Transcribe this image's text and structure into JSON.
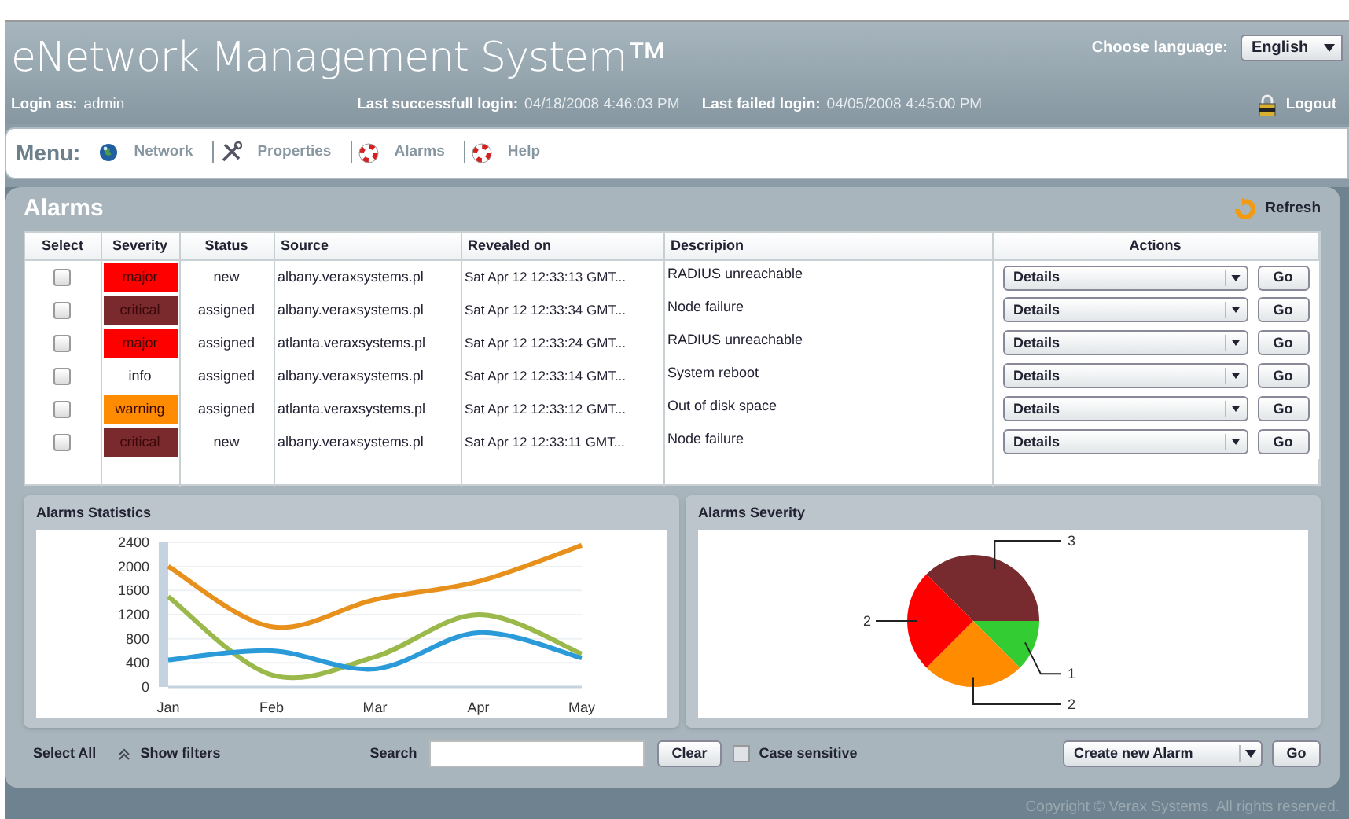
{
  "header": {
    "title": "eNetwork Management System™",
    "language_label": "Choose language:",
    "language": "English",
    "login_label": "Login as:",
    "login_user": "admin",
    "last_success_label": "Last successfull login:",
    "last_success": "04/18/2008 4:46:03 PM",
    "last_failed_label": "Last failed login:",
    "last_failed": "04/05/2008 4:45:00 PM",
    "logout": "Logout"
  },
  "menu": {
    "label": "Menu:",
    "items": [
      {
        "label": "Network"
      },
      {
        "label": "Properties"
      },
      {
        "label": "Alarms"
      },
      {
        "label": "Help"
      }
    ]
  },
  "alarms": {
    "title": "Alarms",
    "refresh": "Refresh",
    "table": {
      "columns": [
        "Select",
        "Severity",
        "Status",
        "Source",
        "Revealed on",
        "Descripion",
        "Actions"
      ],
      "rows": [
        {
          "checked": false,
          "severity": "major",
          "color": "#ff0000",
          "status": "new",
          "source": "albany.veraxsystems.pl",
          "revealed": "Sat Apr 12 12:33:13 GMT...",
          "description": "RADIUS unreachable",
          "action": "Details",
          "go": "Go"
        },
        {
          "checked": false,
          "severity": "critical",
          "color": "#7a2a2c",
          "status": "assigned",
          "source": "albany.veraxsystems.pl",
          "revealed": "Sat Apr 12 12:33:34 GMT...",
          "description": "Node failure",
          "action": "Details",
          "go": "Go"
        },
        {
          "checked": false,
          "severity": "major",
          "color": "#ff0000",
          "status": "assigned",
          "source": "atlanta.veraxsystems.pl",
          "revealed": "Sat Apr 12 12:33:24 GMT...",
          "description": "RADIUS unreachable",
          "action": "Details",
          "go": "Go"
        },
        {
          "checked": false,
          "severity": "info",
          "color": "#ffffff",
          "status": "assigned",
          "source": "albany.veraxsystems.pl",
          "revealed": "Sat Apr 12 12:33:14 GMT...",
          "description": "System reboot",
          "action": "Details",
          "go": "Go"
        },
        {
          "checked": false,
          "severity": "warning",
          "color": "#ff8c00",
          "status": "assigned",
          "source": "atlanta.veraxsystems.pl",
          "revealed": "Sat Apr 12 12:33:12 GMT...",
          "description": "Out of disk space",
          "action": "Details",
          "go": "Go"
        },
        {
          "checked": false,
          "severity": "critical",
          "color": "#7a2a2c",
          "status": "new",
          "source": "albany.veraxsystems.pl",
          "revealed": "Sat Apr 12 12:33:11 GMT...",
          "description": "Node failure",
          "action": "Details",
          "go": "Go"
        }
      ]
    },
    "statistics": {
      "title": "Alarms Statistics",
      "chart_data": {
        "type": "line",
        "categories": [
          "Jan",
          "Feb",
          "Mar",
          "Apr",
          "May"
        ],
        "ylim": [
          0,
          2400
        ],
        "grid": true,
        "yticks": [
          0,
          400,
          800,
          1200,
          1600,
          2000,
          2400
        ],
        "series": [
          {
            "color": "#e8901c",
            "values": [
              2000,
              1000,
              1450,
              1750,
              2350
            ]
          },
          {
            "color": "#9bb84a",
            "values": [
              1500,
              200,
              500,
              1200,
              550
            ]
          },
          {
            "color": "#2a9ad8",
            "values": [
              450,
              600,
              300,
              900,
              480
            ]
          }
        ]
      }
    },
    "severity": {
      "title": "Alarms Severity",
      "chart_data": {
        "type": "pie",
        "values": [
          1,
          2,
          2,
          3
        ],
        "colors": [
          "#33cc33",
          "#ff8c00",
          "#ff0000",
          "#772b2e"
        ],
        "data_labels": true
      }
    },
    "footer": {
      "select_all": "Select All",
      "show_filters": "Show filters",
      "search_label": "Search",
      "clear": "Clear",
      "case_sensitive": "Case sensitive",
      "case_checked": false,
      "create": "Create new Alarm",
      "go": "Go"
    }
  },
  "copyright": "Copyright © Verax Systems. All rights reserved."
}
